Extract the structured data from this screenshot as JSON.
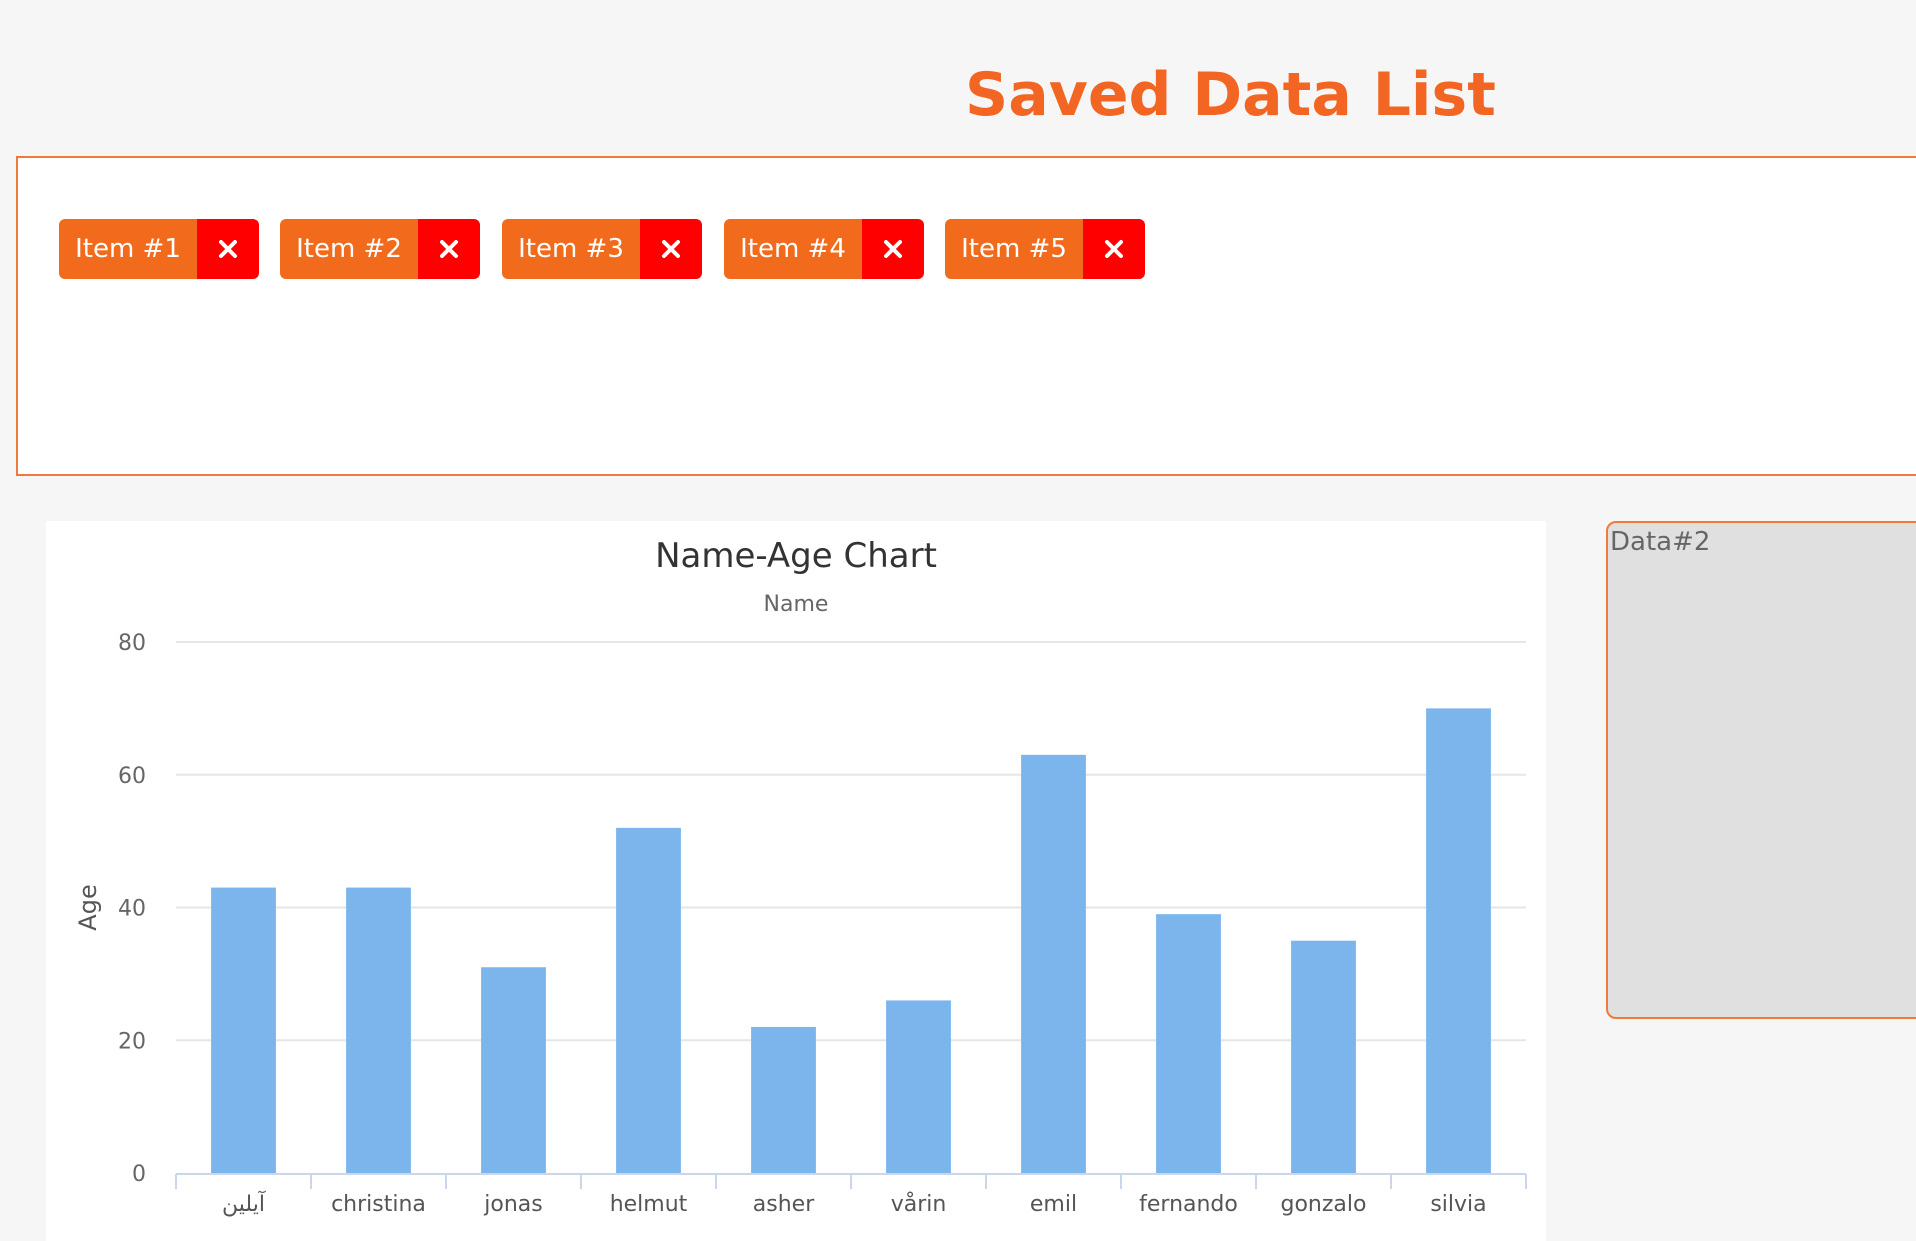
{
  "header": {
    "title": "Saved Data List"
  },
  "saved_items": [
    {
      "label": "Item #1",
      "remove_icon": "close-icon"
    },
    {
      "label": "Item #2",
      "remove_icon": "close-icon"
    },
    {
      "label": "Item #3",
      "remove_icon": "close-icon"
    },
    {
      "label": "Item #4",
      "remove_icon": "close-icon"
    },
    {
      "label": "Item #5",
      "remove_icon": "close-icon"
    }
  ],
  "side_panel": {
    "title": "Data#2"
  },
  "colors": {
    "accent": "#f26522",
    "chip": "#f26b1d",
    "remove": "#ff0000",
    "bar": "#7cb5ec"
  },
  "chart_data": {
    "type": "bar",
    "title": "Name-Age Chart",
    "subtitle": "Name",
    "xlabel": "",
    "ylabel": "Age",
    "categories": [
      "آیلین",
      "christina",
      "jonas",
      "helmut",
      "asher",
      "vårin",
      "emil",
      "fernando",
      "gonzalo",
      "silvia"
    ],
    "values": [
      43,
      43,
      31,
      52,
      22,
      26,
      63,
      39,
      35,
      70
    ],
    "ylim": [
      0,
      80
    ],
    "yticks": [
      0,
      20,
      40,
      60,
      80
    ],
    "grid": true,
    "legend": "none"
  }
}
